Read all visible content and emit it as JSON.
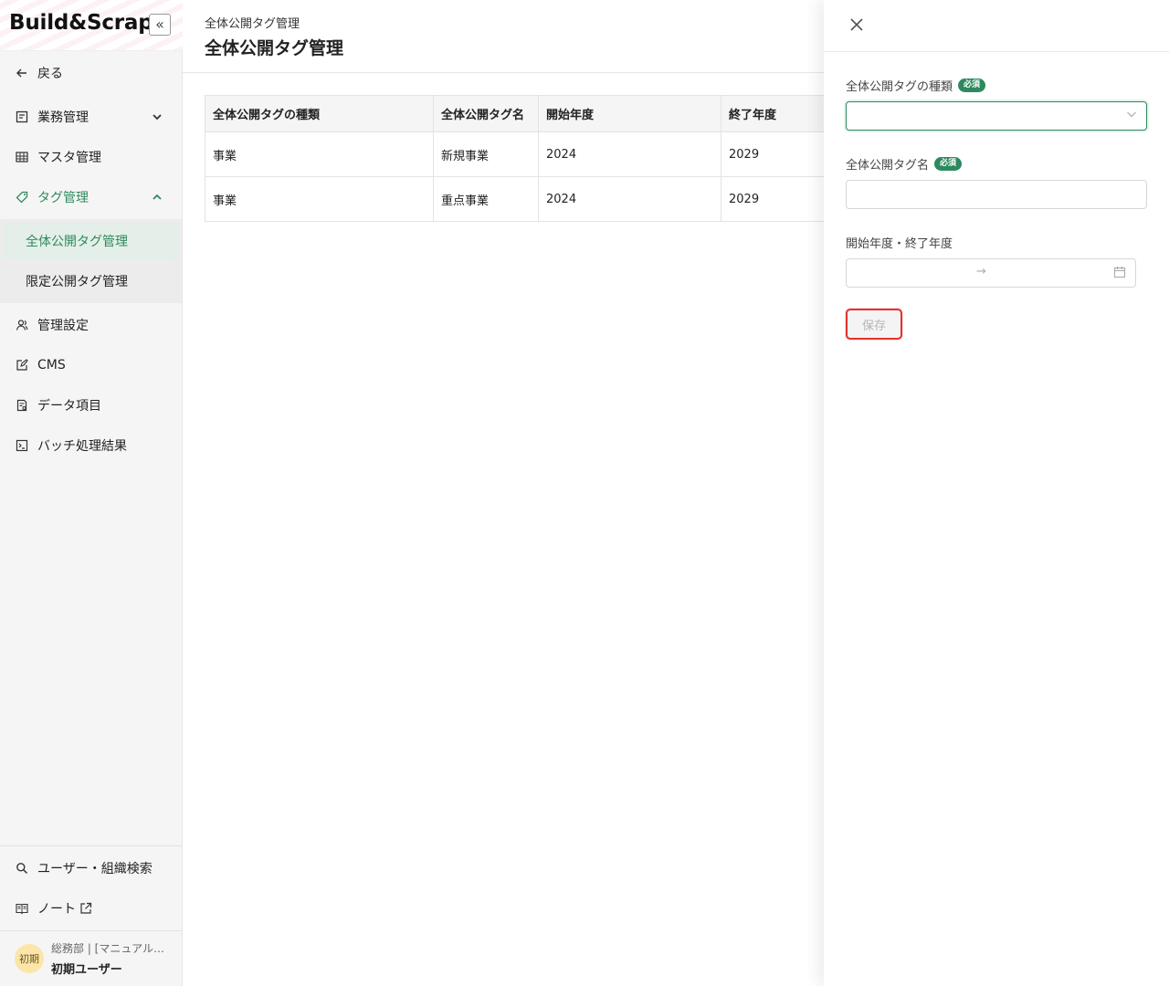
{
  "logo": {
    "text": "Build&Scrap",
    "collapse_glyph": "«"
  },
  "sidebar": {
    "back": {
      "label": "戻る",
      "icon": "arrow-left-icon"
    },
    "items": [
      {
        "label": "業務管理",
        "icon": "task-icon",
        "expandable": true,
        "expanded": false
      },
      {
        "label": "マスタ管理",
        "icon": "table-icon"
      },
      {
        "label": "タグ管理",
        "icon": "tag-icon",
        "expandable": true,
        "expanded": true
      },
      {
        "label": "管理設定",
        "icon": "users-icon"
      },
      {
        "label": "CMS",
        "icon": "edit-icon"
      },
      {
        "label": "データ項目",
        "icon": "document-icon"
      },
      {
        "label": "バッチ処理結果",
        "icon": "terminal-icon"
      }
    ],
    "submenu": [
      {
        "label": "全体公開タグ管理",
        "selected": true
      },
      {
        "label": "限定公開タグ管理",
        "selected": false
      }
    ],
    "bottom": [
      {
        "label": "ユーザー・組織検索",
        "icon": "search-icon"
      },
      {
        "label": "ノート",
        "icon": "book-icon",
        "external": true
      }
    ],
    "user": {
      "avatar": "初期",
      "department": "総務部 | [マニュアル…",
      "name": "初期ユーザー"
    }
  },
  "header": {
    "breadcrumb": "全体公開タグ管理",
    "title": "全体公開タグ管理"
  },
  "table": {
    "columns": [
      "全体公開タグの種類",
      "全体公開タグ名",
      "開始年度",
      "終了年度"
    ],
    "rows": [
      [
        "事業",
        "新規事業",
        "2024",
        "2029"
      ],
      [
        "事業",
        "重点事業",
        "2024",
        "2029"
      ]
    ]
  },
  "drawer": {
    "fields": {
      "tag_type": {
        "label": "全体公開タグの種類",
        "required_badge": "必須",
        "value": ""
      },
      "tag_name": {
        "label": "全体公開タグ名",
        "required_badge": "必須",
        "value": "",
        "placeholder": ""
      },
      "period": {
        "label": "開始年度・終了年度",
        "start": "",
        "end": "",
        "separator": "→"
      }
    },
    "save_label": "保存",
    "save_disabled": true
  },
  "colors": {
    "accent": "#2e8a5e",
    "highlight": "#e2332e",
    "selected_bg": "#e3efe8",
    "avatar_bg": "#fbe6a8"
  }
}
